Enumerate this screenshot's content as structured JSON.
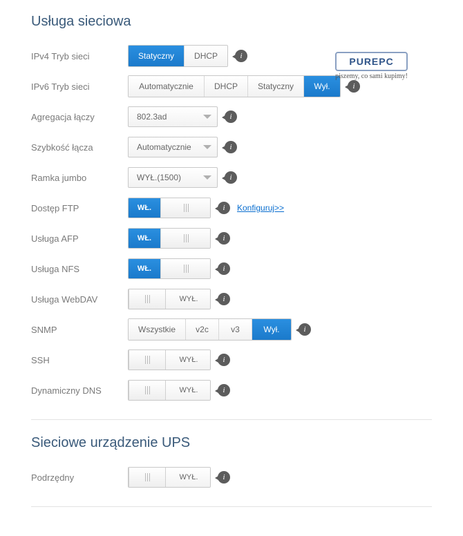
{
  "section1": {
    "title": "Usługa sieciowa"
  },
  "section2": {
    "title": "Sieciowe urządzenie UPS"
  },
  "ipv4": {
    "label": "IPv4 Tryb sieci",
    "static": "Statyczny",
    "dhcp": "DHCP"
  },
  "ipv6": {
    "label": "IPv6 Tryb sieci",
    "auto": "Automatycznie",
    "dhcp": "DHCP",
    "static": "Statyczny",
    "off": "Wył."
  },
  "agg": {
    "label": "Agregacja łączy",
    "value": "802.3ad"
  },
  "speed": {
    "label": "Szybkość łącza",
    "value": "Automatycznie"
  },
  "jumbo": {
    "label": "Ramka jumbo",
    "value": "WYŁ.(1500)"
  },
  "ftp": {
    "label": "Dostęp FTP",
    "on": "WŁ.",
    "config": "Konfiguruj>>"
  },
  "afp": {
    "label": "Usługa AFP",
    "on": "WŁ."
  },
  "nfs": {
    "label": "Usługa NFS",
    "on": "WŁ."
  },
  "webdav": {
    "label": "Usługa WebDAV",
    "off": "WYŁ."
  },
  "snmp": {
    "label": "SNMP",
    "all": "Wszystkie",
    "v2c": "v2c",
    "v3": "v3",
    "off": "Wył."
  },
  "ssh": {
    "label": "SSH",
    "off": "WYŁ."
  },
  "ddns": {
    "label": "Dynamiczny DNS",
    "off": "WYŁ."
  },
  "ups": {
    "label": "Podrzędny",
    "off": "WYŁ."
  },
  "info": "i",
  "logo": {
    "brand": "PUREPC",
    "tag": "piszemy, co sami kupimy!"
  }
}
